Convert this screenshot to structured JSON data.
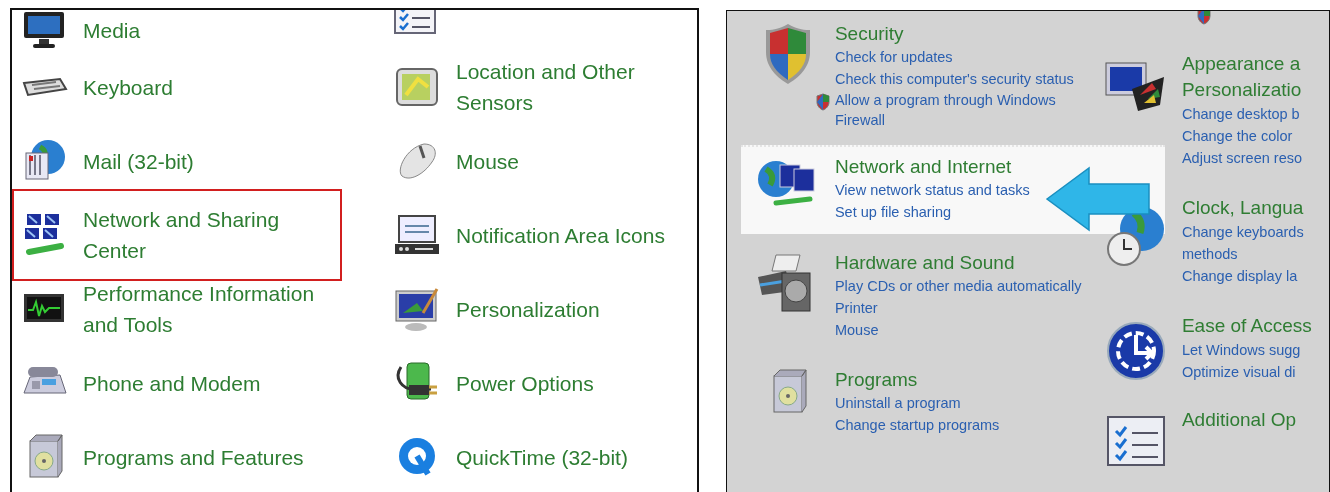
{
  "left_panel": {
    "columns": [
      {
        "items": [
          {
            "label": "Media",
            "selected": false
          },
          {
            "label": "Keyboard",
            "selected": false
          },
          {
            "label": "Mail (32-bit)",
            "selected": false
          },
          {
            "label": "Network and Sharing Center",
            "selected": true
          },
          {
            "label": "Performance Information and Tools",
            "selected": false
          },
          {
            "label": "Phone and Modem",
            "selected": false
          },
          {
            "label": "Programs and Features",
            "selected": false
          }
        ]
      },
      {
        "items": [
          {
            "label": "Location and Other Sensors",
            "selected": false
          },
          {
            "label": "Mouse",
            "selected": false
          },
          {
            "label": "Notification Area Icons",
            "selected": false
          },
          {
            "label": "Personalization",
            "selected": false
          },
          {
            "label": "Power Options",
            "selected": false
          },
          {
            "label": "QuickTime (32-bit)",
            "selected": false
          }
        ]
      }
    ]
  },
  "right_panel": {
    "columns": [
      {
        "categories": [
          {
            "title_lines": [
              "Security"
            ],
            "selected": false,
            "links": [
              {
                "text": "Check for updates",
                "kind": "plain"
              },
              {
                "text": "Check this computer's security status",
                "kind": "plain"
              },
              {
                "text": "Allow a program through Windows Firewall",
                "kind": "shield"
              }
            ]
          },
          {
            "title_lines": [
              "Network and Internet"
            ],
            "selected": true,
            "links": [
              {
                "text": "View network status and tasks",
                "kind": "plain"
              },
              {
                "text": "Set up file sharing",
                "kind": "plain"
              }
            ]
          },
          {
            "title_lines": [
              "Hardware and Sound"
            ],
            "selected": false,
            "links": [
              {
                "text": "Play CDs or other media automatically",
                "kind": "plain"
              },
              {
                "text": "Printer",
                "kind": "plain"
              },
              {
                "text": "Mouse",
                "kind": "plain"
              }
            ]
          },
          {
            "title_lines": [
              "Programs"
            ],
            "selected": false,
            "links": [
              {
                "text": "Uninstall a program",
                "kind": "plain"
              },
              {
                "text": "Change startup programs",
                "kind": "plain"
              }
            ]
          }
        ]
      },
      {
        "categories": [
          {
            "title_lines": [
              "Appearance a",
              "Personalizatio"
            ],
            "selected": false,
            "links": [
              {
                "text": "Change desktop b",
                "kind": "plain"
              },
              {
                "text": "Change the color",
                "kind": "plain"
              },
              {
                "text": "Adjust screen reso",
                "kind": "plain"
              }
            ]
          },
          {
            "title_lines": [
              "Clock, Langua"
            ],
            "selected": false,
            "links": [
              {
                "text": "Change keyboards",
                "kind": "plain"
              },
              {
                "text": "methods",
                "kind": "plain"
              },
              {
                "text": "Change display la",
                "kind": "plain"
              }
            ]
          },
          {
            "title_lines": [
              "Ease of Access"
            ],
            "selected": false,
            "links": [
              {
                "text": "Let Windows sugg",
                "kind": "plain"
              },
              {
                "text": "Optimize visual di",
                "kind": "plain"
              }
            ]
          },
          {
            "title_lines": [
              "Additional Op"
            ],
            "selected": false
          }
        ]
      }
    ]
  }
}
